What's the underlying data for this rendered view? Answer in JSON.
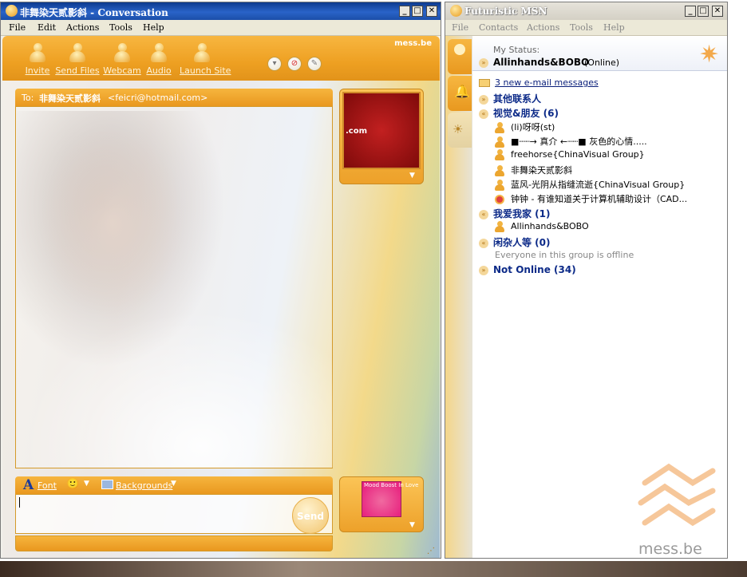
{
  "conversation": {
    "title": "非舞染天贰影斜 - Conversation",
    "menu": [
      "File",
      "Edit",
      "Actions",
      "Tools",
      "Help"
    ],
    "toolbar": {
      "invite": "Invite",
      "send_files": "Send Files",
      "webcam": "Webcam",
      "audio": "Audio",
      "launch_site": "Launch Site",
      "brand": "mess.be"
    },
    "to_label": "To:",
    "to_name": "非舞染天贰影斜",
    "to_email": "<feicri@hotmail.com>",
    "display_pic_text": ".com",
    "compose": {
      "font_label": "Font",
      "backgrounds_label": "Backgrounds",
      "send_label": "Send",
      "input_value": ""
    },
    "my_pic_text": "Mood Boost In Love"
  },
  "msn": {
    "title": "Futuristic MSN",
    "menu": [
      "File",
      "Contacts",
      "Actions",
      "Tools",
      "Help"
    ],
    "my_status_label": "My Status:",
    "my_name": "Allinhands&BOBO",
    "my_state": "(Online)",
    "email_link": "3 new e-mail messages",
    "groups": [
      {
        "name": "其他联系人",
        "expanded": false,
        "contacts": []
      },
      {
        "name": "视觉&朋友 (6)",
        "expanded": true,
        "contacts": [
          {
            "name": "(li)呀呀(st)",
            "status": "online"
          },
          {
            "name": "■┈┈→ 真介 ←┈┈■    灰色的心情.....",
            "status": "online"
          },
          {
            "name": "freehorse{ChinaVisual Group}",
            "status": "online"
          },
          {
            "name": "非舞染天贰影斜",
            "status": "online"
          },
          {
            "name": "蓝风-光阴从指缝流逝{ChinaVisual Group}",
            "status": "online"
          },
          {
            "name": "钟钟 - 有谁知道关于计算机辅助设计（CAD...",
            "status": "busy"
          }
        ]
      },
      {
        "name": "我爱我家 (1)",
        "expanded": true,
        "contacts": [
          {
            "name": "Allinhands&BOBO",
            "status": "online"
          }
        ]
      },
      {
        "name": "闲杂人等 (0)",
        "expanded": true,
        "offline_note": "Everyone in this group is offline",
        "contacts": []
      },
      {
        "name": "Not Online (34)",
        "expanded": false,
        "contacts": []
      }
    ],
    "brand": "mess.be"
  },
  "colors": {
    "accent_orange": "#eea022",
    "group_blue": "#0c2a88",
    "titlebar_blue": "#1b4ea8"
  }
}
